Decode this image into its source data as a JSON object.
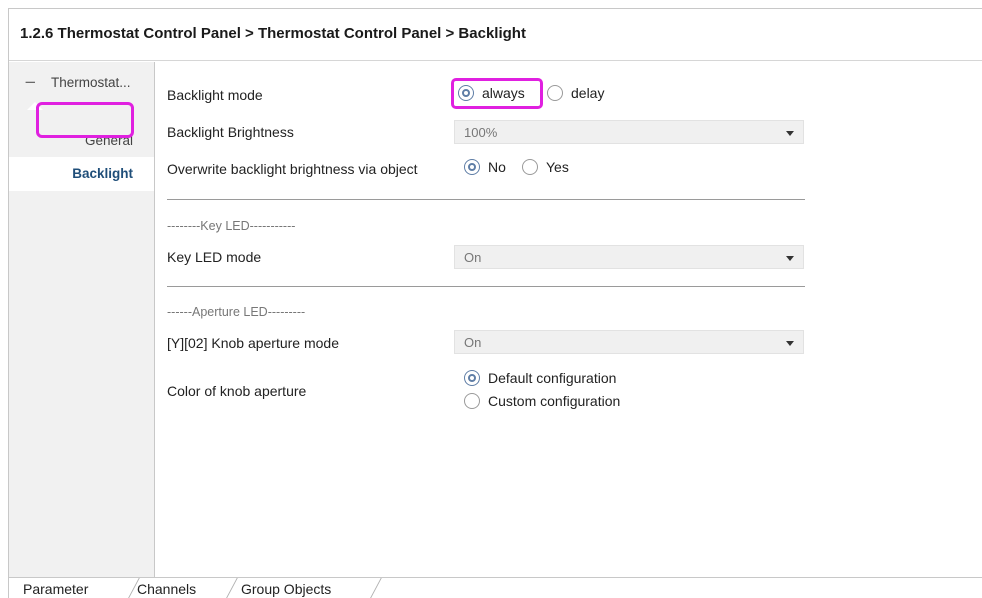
{
  "breadcrumb": "1.2.6 Thermostat Control Panel > Thermostat Control Panel > Backlight",
  "sidebar": {
    "root_toggle": "−",
    "root_label": "Thermostat...",
    "items": [
      {
        "label": "General"
      },
      {
        "label": "Backlight",
        "selected": true
      }
    ]
  },
  "params": {
    "backlight_mode": {
      "label": "Backlight mode",
      "options": [
        "always",
        "delay"
      ],
      "selected": "always"
    },
    "backlight_brightness": {
      "label": "Backlight Brightness",
      "value": "100%"
    },
    "overwrite_brightness": {
      "label": "Overwrite backlight brightness via object",
      "options": [
        "No",
        "Yes"
      ],
      "selected": "No"
    },
    "key_led_section": "--------Key LED-----------",
    "key_led_mode": {
      "label": "Key LED mode",
      "value": "On"
    },
    "aperture_section": "------Aperture LED---------",
    "knob_aperture_mode": {
      "label": "[Y][02] Knob aperture mode",
      "value": "On"
    },
    "knob_color": {
      "label": "Color of knob aperture",
      "options": [
        "Default configuration",
        "Custom configuration"
      ],
      "selected": "Default configuration"
    }
  },
  "tabs": [
    {
      "label": "Parameter",
      "active": true
    },
    {
      "label": "Channels"
    },
    {
      "label": "Group Objects"
    }
  ],
  "colors": {
    "highlight": "#e020e0",
    "accent": "#1f4e79",
    "radio": "#5f7ea6"
  }
}
